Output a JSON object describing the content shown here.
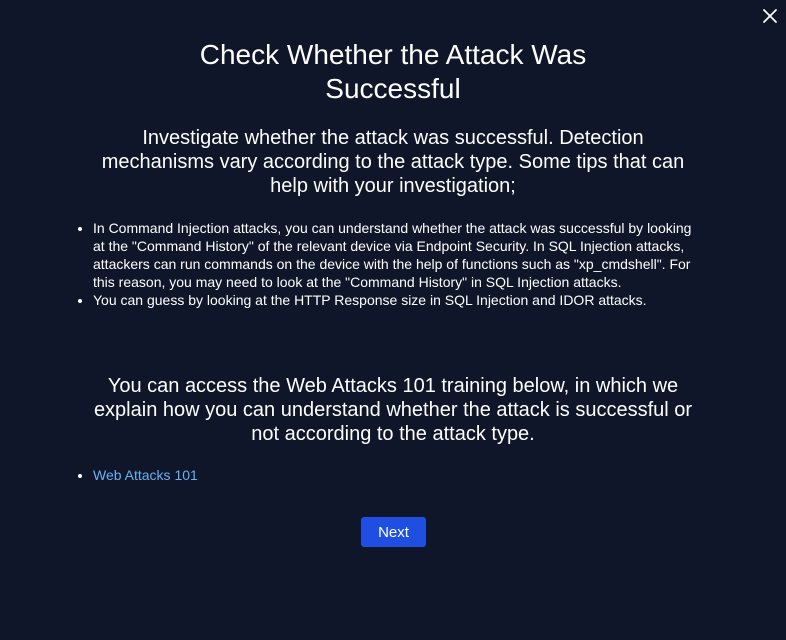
{
  "modal": {
    "title": "Check Whether the Attack Was Successful",
    "intro": "Investigate whether the attack was successful. Detection mechanisms vary according to the attack type. Some tips that can help with your investigation;",
    "tips": [
      "In Command Injection attacks, you can understand whether the attack was successful by looking at the \"Command History\" of the relevant device via Endpoint Security. In SQL Injection attacks, attackers can run commands on the device with the help of functions such as \"xp_cmdshell\". For this reason, you may need to look at the \"Command History\" in SQL Injection attacks.",
      "You can guess by looking at the HTTP Response size in SQL Injection and IDOR attacks."
    ],
    "access_text": "You can access the Web Attacks 101 training below, in which we explain how you can understand whether the attack is successful or not according to the attack type.",
    "links": [
      "Web Attacks 101"
    ],
    "next_label": "Next",
    "close_icon": "close-icon"
  },
  "colors": {
    "background": "#0f1629",
    "text": "#ffffff",
    "link": "#6ab0f3",
    "button": "#1e4fe0"
  }
}
